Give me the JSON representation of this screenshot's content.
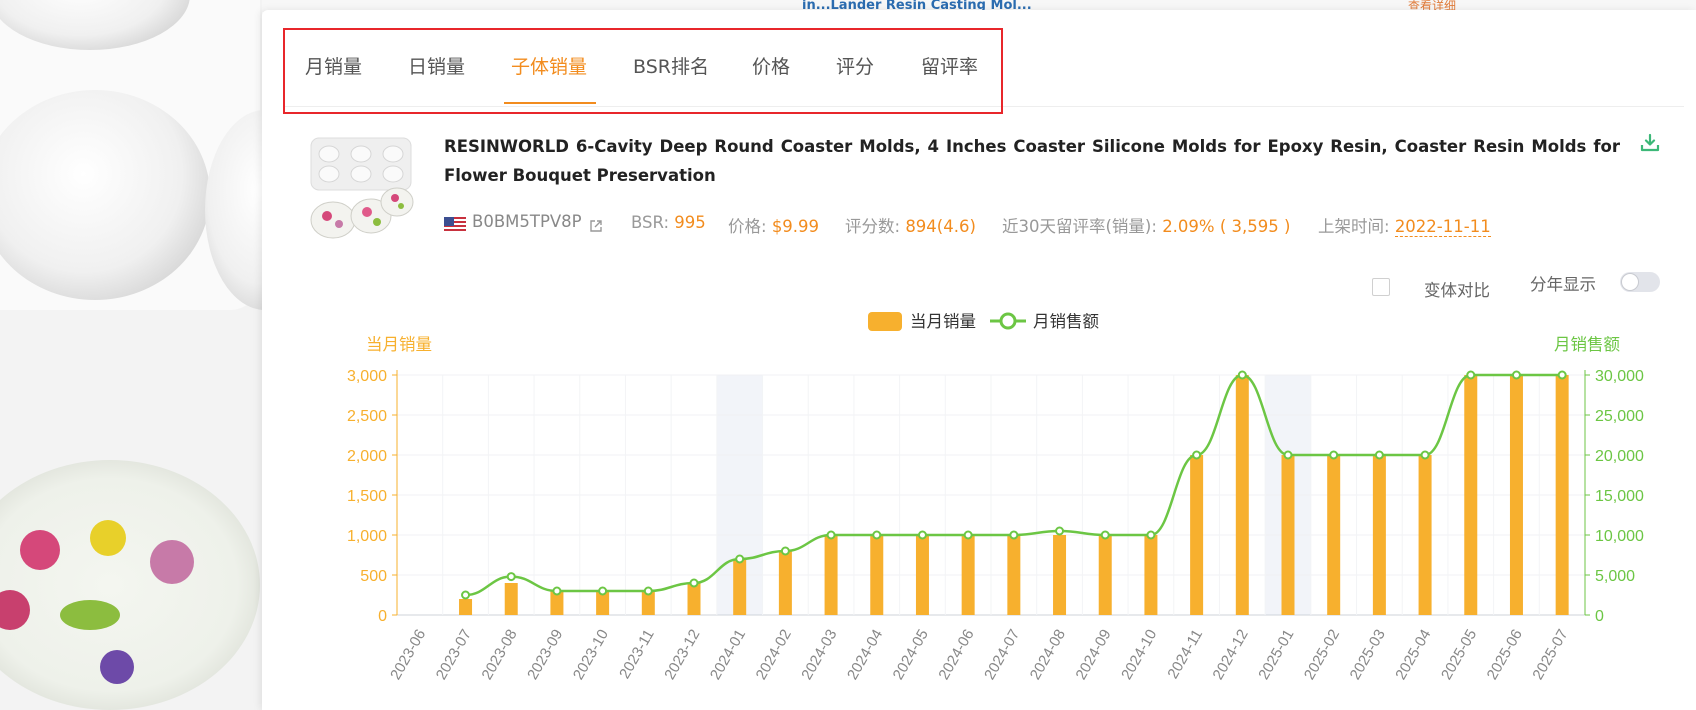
{
  "background": {
    "partial_title": "in...Lander Resin Casting Mol...",
    "partial_link": "查看详细"
  },
  "tabs": [
    {
      "label": "月销量",
      "active": false
    },
    {
      "label": "日销量",
      "active": false
    },
    {
      "label": "子体销量",
      "active": true
    },
    {
      "label": "BSR排名",
      "active": false
    },
    {
      "label": "价格",
      "active": false
    },
    {
      "label": "评分",
      "active": false
    },
    {
      "label": "留评率",
      "active": false
    }
  ],
  "product": {
    "title": "RESINWORLD 6-Cavity Deep Round Coaster Molds, 4 Inches Coaster Silicone Molds for Epoxy Resin, Coaster Resin Molds for Flower Bouquet Preservation",
    "asin": "B0BM5TPV8P",
    "bsr_label": "BSR:",
    "bsr_value": "995",
    "price_label": "价格:",
    "price_value": "$9.99",
    "reviews_label": "评分数:",
    "reviews_value": "894(4.6)",
    "review_rate_label": "近30天留评率(销量):",
    "review_rate_value": "2.09% ( 3,595 )",
    "listed_label": "上架时间:",
    "listed_value": "2022-11-11"
  },
  "options": {
    "variant_compare_label": "变体对比",
    "variant_compare_checked": false,
    "by_year_label": "分年显示",
    "by_year_on": false
  },
  "colors": {
    "accent": "#f28c1e",
    "bar": "#f7b02e",
    "line": "#6cc644",
    "highlight_border": "#e8262b"
  },
  "icons": {
    "download": "download-icon",
    "external_link": "external-link-icon",
    "flag": "us-flag-icon"
  },
  "chart_data": {
    "type": "bar",
    "categories": [
      "2023-06",
      "2023-07",
      "2023-08",
      "2023-09",
      "2023-10",
      "2023-11",
      "2023-12",
      "2024-01",
      "2024-02",
      "2024-03",
      "2024-04",
      "2024-05",
      "2024-06",
      "2024-07",
      "2024-08",
      "2024-09",
      "2024-10",
      "2024-11",
      "2024-12",
      "2025-01",
      "2025-02",
      "2025-03",
      "2025-04",
      "2025-05",
      "2025-06",
      "2025-07"
    ],
    "series": [
      {
        "name": "当月销量",
        "kind": "bar",
        "axis": "left",
        "values": [
          null,
          200,
          400,
          300,
          300,
          300,
          400,
          700,
          800,
          1000,
          1000,
          1000,
          1000,
          1000,
          1000,
          1000,
          1000,
          2000,
          3000,
          2000,
          2000,
          2000,
          2000,
          3000,
          3000,
          3000
        ]
      },
      {
        "name": "月销售额",
        "kind": "line",
        "axis": "right",
        "values": [
          null,
          2500,
          4800,
          3000,
          3000,
          3000,
          4000,
          7000,
          8000,
          10000,
          10000,
          10000,
          10000,
          10000,
          10500,
          10000,
          10000,
          20000,
          30000,
          20000,
          20000,
          20000,
          20000,
          30000,
          30000,
          30000
        ]
      }
    ],
    "ylabel_left": "当月销量",
    "ylabel_right": "月销售额",
    "ylim_left": [
      0,
      3000
    ],
    "ylim_right": [
      0,
      30000
    ],
    "yticks_left": [
      "0",
      "500",
      "1,000",
      "1,500",
      "2,000",
      "2,500",
      "3,000"
    ],
    "yticks_right": [
      "0",
      "5,000",
      "10,000",
      "15,000",
      "20,000",
      "25,000",
      "30,000"
    ],
    "shaded_categories": [
      "2024-01",
      "2025-01"
    ],
    "legend_position": "top",
    "grid": true
  }
}
